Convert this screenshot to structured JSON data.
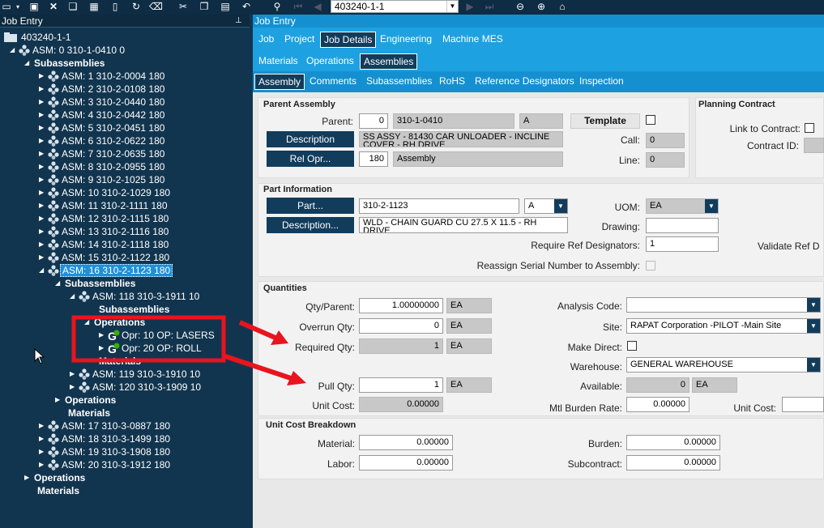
{
  "toolbar": {
    "job_number": "403240-1-1"
  },
  "left_panel": {
    "title": "Job Entry"
  },
  "tree": {
    "root": "403240-1-1",
    "asm0": "ASM: 0 310-1-0410 0",
    "subassemblies": "Subassemblies",
    "asm_items": [
      "ASM: 1 310-2-0004 180",
      "ASM: 2 310-2-0108 180",
      "ASM: 3 310-2-0440 180",
      "ASM: 4 310-2-0442 180",
      "ASM: 5 310-2-0451 180",
      "ASM: 6 310-2-0622 180",
      "ASM: 7 310-2-0635 180",
      "ASM: 8 310-2-0955 180",
      "ASM: 9 310-2-1025 180",
      "ASM: 10 310-2-1029 180",
      "ASM: 11 310-2-1111 180",
      "ASM: 12 310-2-1115 180",
      "ASM: 13 310-2-1116 180",
      "ASM: 14 310-2-1118 180",
      "ASM: 15 310-2-1122 180",
      "ASM: 16 310-2-1123 180"
    ],
    "asm16_sub": "Subassemblies",
    "asm118": "ASM: 118 310-3-1911 10",
    "asm118_sub": "Subassemblies",
    "asm118_ops": "Operations",
    "opr10": "Opr: 10 OP: LASERS",
    "opr20": "Opr: 20 OP: ROLL",
    "asm118_mat": "Materials",
    "asm119": "ASM: 119 310-3-1910 10",
    "asm120": "ASM: 120 310-3-1909 10",
    "asm16_ops": "Operations",
    "asm16_mat": "Materials",
    "asm_tail": [
      "ASM: 17 310-3-0887 180",
      "ASM: 18 310-3-1499 180",
      "ASM: 19 310-3-1908 180",
      "ASM: 20 310-3-1912 180"
    ],
    "root_ops": "Operations",
    "root_mat": "Materials"
  },
  "right_panel": {
    "title": "Job Entry"
  },
  "tabs1": [
    "Job",
    "Project",
    "Job Details",
    "Engineering",
    "Machine MES"
  ],
  "tabs2": [
    "Materials",
    "Operations",
    "Assemblies"
  ],
  "tabs3": [
    "Assembly",
    "Comments",
    "Subassemblies",
    "RoHS",
    "Reference Designators",
    "Inspection"
  ],
  "parent_assembly": {
    "title": "Parent Assembly",
    "parent_label": "Parent:",
    "parent_seq": "0",
    "parent_part": "310-1-0410",
    "parent_rev": "A",
    "template_label": "Template",
    "description_btn": "Description",
    "description": "SS ASSY - 81430 CAR UNLOADER - INCLINE COVER - RH DRIVE",
    "call_label": "Call:",
    "call": "0",
    "relopr_btn": "Rel Opr...",
    "relopr": "180",
    "relopr_desc": "Assembly",
    "line_label": "Line:",
    "line": "0"
  },
  "planning_contract": {
    "title": "Planning Contract",
    "link_label": "Link to Contract:",
    "contract_id_label": "Contract ID:"
  },
  "part_info": {
    "title": "Part Information",
    "part_btn": "Part...",
    "part": "310-2-1123",
    "rev": "A",
    "desc_btn": "Description...",
    "description": "WLD - CHAIN GUARD CU 27.5 X 11.5 - RH DRIVE",
    "uom_label": "UOM:",
    "uom": "EA",
    "drawing_label": "Drawing:",
    "require_ref_label": "Require Ref Designators:",
    "require_ref": "1",
    "validate_ref_label": "Validate Ref D",
    "reassign_label": "Reassign Serial Number to Assembly:"
  },
  "quantities": {
    "title": "Quantities",
    "qty_parent_label": "Qty/Parent:",
    "qty_parent": "1.00000000",
    "qty_parent_uom": "EA",
    "overrun_label": "Overrun Qty:",
    "overrun": "0",
    "overrun_uom": "EA",
    "required_label": "Required Qty:",
    "required": "1",
    "required_uom": "EA",
    "pull_label": "Pull Qty:",
    "pull": "1",
    "pull_uom": "EA",
    "unit_cost_label": "Unit Cost:",
    "unit_cost": "0.00000",
    "analysis_label": "Analysis Code:",
    "analysis": "",
    "site_label": "Site:",
    "site": "RAPAT Corporation -PILOT -Main Site",
    "make_direct_label": "Make Direct:",
    "warehouse_label": "Warehouse:",
    "warehouse": "GENERAL WAREHOUSE",
    "available_label": "Available:",
    "available": "0",
    "available_uom": "EA",
    "mtl_burden_label": "Mtl Burden Rate:",
    "mtl_burden": "0.00000",
    "unit_cost2_label": "Unit Cost:"
  },
  "cost_breakdown": {
    "title": "Unit Cost Breakdown",
    "material_label": "Material:",
    "material": "0.00000",
    "labor_label": "Labor:",
    "labor": "0.00000",
    "burden_label": "Burden:",
    "burden": "0.00000",
    "subcontract_label": "Subcontract:",
    "subcontract": "0.00000"
  },
  "colors": {
    "highlight_box": "#e8141e",
    "arrow": "#e8141e",
    "tab_bar": "#1ea1e0",
    "tree_bg": "#12354f"
  }
}
